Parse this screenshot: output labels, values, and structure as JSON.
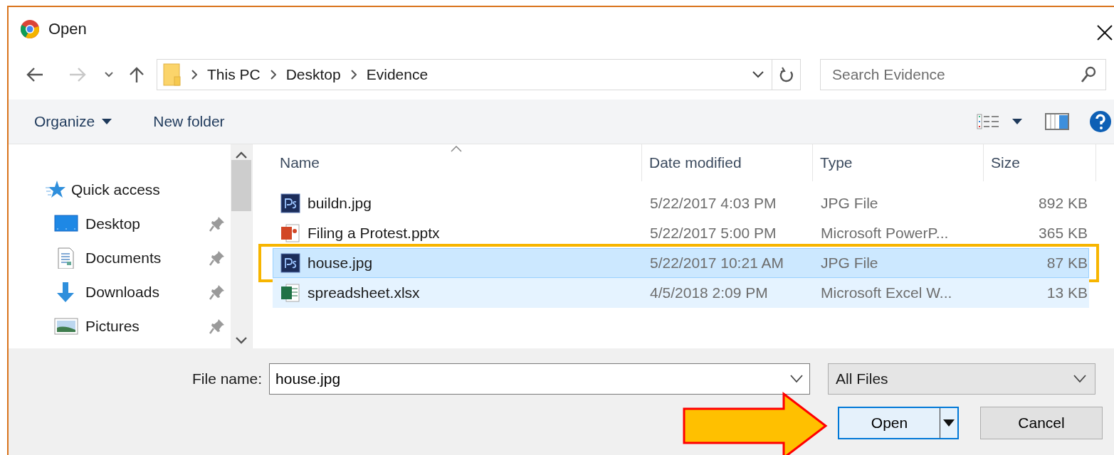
{
  "window": {
    "title": "Open"
  },
  "navigation": {
    "path": [
      "This PC",
      "Desktop",
      "Evidence"
    ],
    "search": {
      "placeholder": "Search Evidence"
    }
  },
  "toolbar": {
    "organize": "Organize",
    "new_folder": "New folder"
  },
  "sidebar": {
    "items": [
      {
        "label": "Quick access",
        "kind": "star",
        "pinned": false
      },
      {
        "label": "Desktop",
        "kind": "desktop",
        "pinned": true
      },
      {
        "label": "Documents",
        "kind": "documents",
        "pinned": true
      },
      {
        "label": "Downloads",
        "kind": "downloads",
        "pinned": true
      },
      {
        "label": "Pictures",
        "kind": "pictures",
        "pinned": true
      }
    ]
  },
  "table": {
    "columns": [
      "Name",
      "Date modified",
      "Type",
      "Size"
    ],
    "rows": [
      {
        "name": "buildn.jpg",
        "kind": "ps",
        "date": "5/22/2017 4:03 PM",
        "type": "JPG File",
        "size": "892 KB",
        "selected": false,
        "hovered": false,
        "outlined": false
      },
      {
        "name": "Filing a Protest.pptx",
        "kind": "ppt",
        "date": "5/22/2017 5:00 PM",
        "type": "Microsoft PowerP...",
        "size": "365 KB",
        "selected": false,
        "hovered": false,
        "outlined": false
      },
      {
        "name": "house.jpg",
        "kind": "ps",
        "date": "5/22/2017 10:21 AM",
        "type": "JPG File",
        "size": "87 KB",
        "selected": true,
        "hovered": false,
        "outlined": true
      },
      {
        "name": "spreadsheet.xlsx",
        "kind": "xls",
        "date": "4/5/2018 2:09 PM",
        "type": "Microsoft Excel W...",
        "size": "13 KB",
        "selected": false,
        "hovered": true,
        "outlined": false
      }
    ]
  },
  "footer": {
    "file_name_label": "File name:",
    "file_name": "house.jpg",
    "filter": "All Files",
    "open": "Open",
    "cancel": "Cancel",
    "arrow_to_open": true
  }
}
